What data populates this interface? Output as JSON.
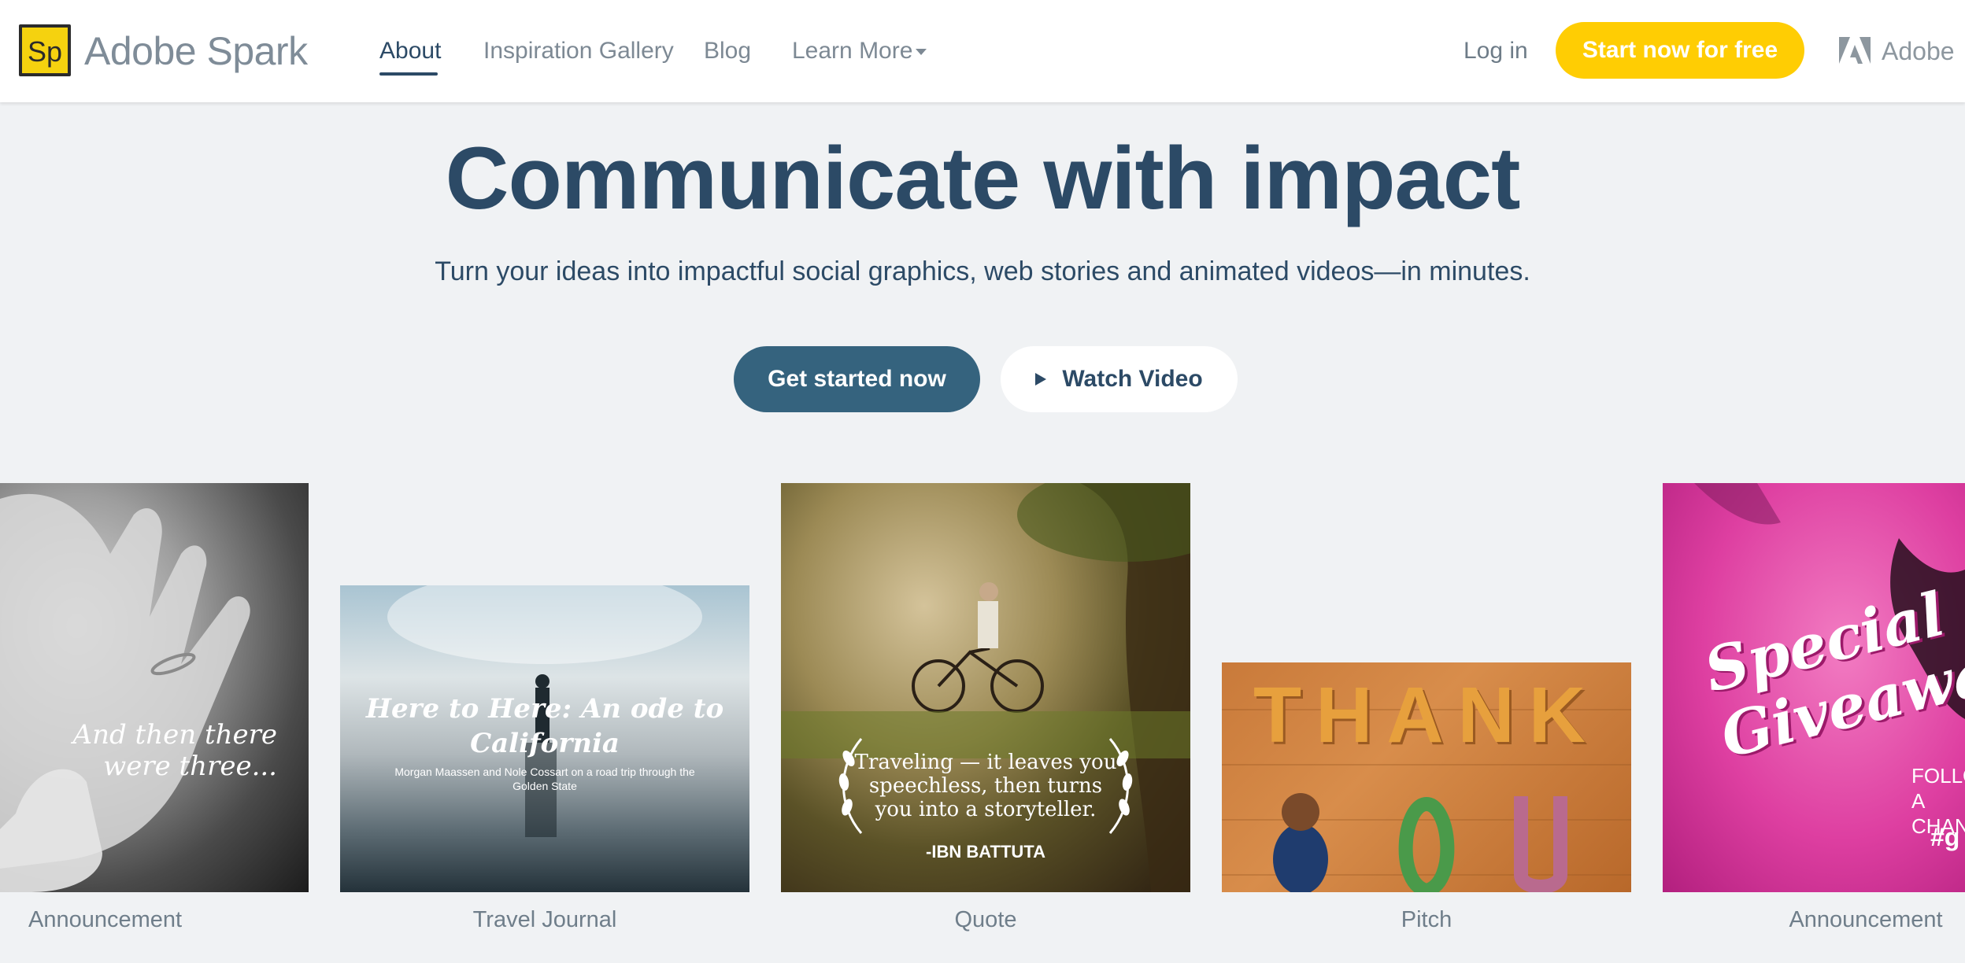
{
  "nav": {
    "logo_mark": "Sp",
    "brand": "Adobe Spark",
    "links": [
      {
        "label": "About"
      },
      {
        "label": "Inspiration Gallery"
      },
      {
        "label": "Blog"
      },
      {
        "label": "Learn More"
      }
    ],
    "login": "Log in",
    "cta": "Start now for free",
    "adobe_label": "Adobe"
  },
  "hero": {
    "title": "Communicate with impact",
    "subtitle": "Turn your ideas into impactful social graphics, web stories and animated videos—in minutes.",
    "primary_button": "Get started now",
    "video_button": "Watch Video"
  },
  "cards": [
    {
      "label": "Announcement",
      "overlay": "And then there were three..."
    },
    {
      "label": "Travel Journal",
      "overlay_title": "Here to Here: An ode to California",
      "overlay_sub": "Morgan Maassen and Nole Cossart on a road trip through the Golden State"
    },
    {
      "label": "Quote",
      "quote": "Traveling — it leaves you speechless, then turns you into a storyteller.",
      "author": "-IBN BATTUTA"
    },
    {
      "label": "Pitch",
      "overlay": "THANK"
    },
    {
      "label": "Announcement",
      "overlay_title": "Special Giveawa",
      "follow": "FOLLOW A CHAN",
      "tag": "#g"
    }
  ],
  "colors": {
    "navy": "#2c4a66",
    "accent_yellow": "#ffcd03",
    "primary_button": "#35637e",
    "background": "#f0f2f4"
  }
}
